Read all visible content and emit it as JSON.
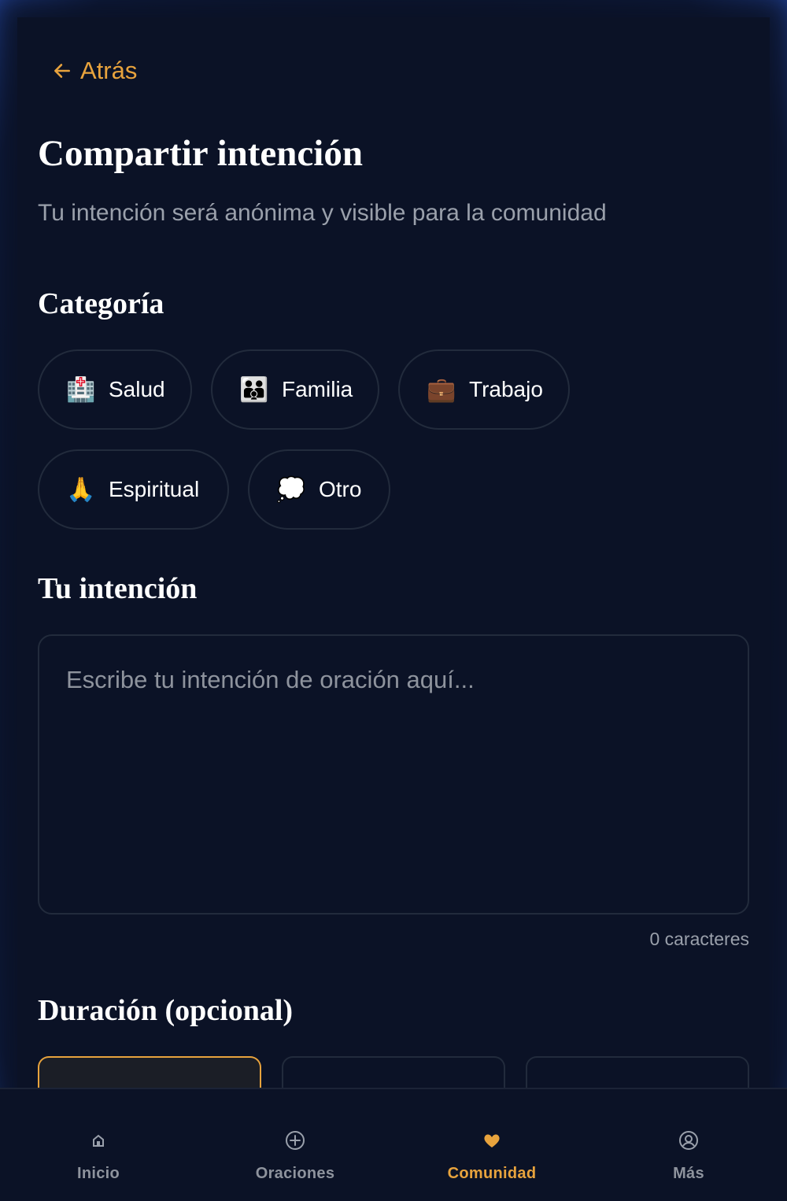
{
  "header": {
    "back_label": "Atrás",
    "title": "Compartir intención",
    "subtitle": "Tu intención será anónima y visible para la comunidad"
  },
  "category": {
    "heading": "Categoría",
    "options": [
      {
        "emoji": "🏥",
        "label": "Salud"
      },
      {
        "emoji": "👪",
        "label": "Familia"
      },
      {
        "emoji": "💼",
        "label": "Trabajo"
      },
      {
        "emoji": "🙏",
        "label": "Espiritual"
      },
      {
        "emoji": "💭",
        "label": "Otro"
      }
    ]
  },
  "intention": {
    "heading": "Tu intención",
    "placeholder": "Escribe tu intención de oración aquí...",
    "value": "",
    "counter": "0 caracteres"
  },
  "duration": {
    "heading": "Duración (opcional)"
  },
  "nav": {
    "items": [
      {
        "label": "Inicio",
        "icon": "home-icon"
      },
      {
        "label": "Oraciones",
        "icon": "plus-circle-icon"
      },
      {
        "label": "Comunidad",
        "icon": "heart-hands-icon"
      },
      {
        "label": "Más",
        "icon": "user-circle-icon"
      }
    ],
    "active": "Comunidad"
  },
  "colors": {
    "accent": "#e8a33d",
    "background": "#0b1226",
    "border": "#222b3c",
    "muted_text": "#9aa0ab"
  }
}
